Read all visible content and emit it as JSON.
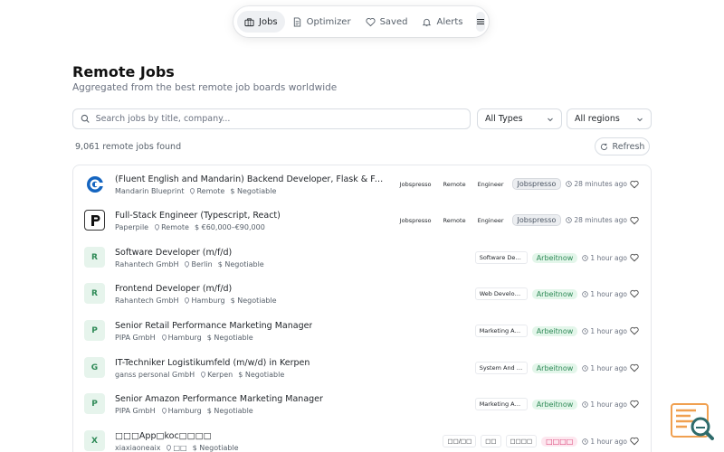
{
  "nav": {
    "items": [
      {
        "label": "Jobs",
        "icon": "briefcase-icon",
        "active": true
      },
      {
        "label": "Optimizer",
        "icon": "document-icon",
        "active": false
      },
      {
        "label": "Saved",
        "icon": "heart-icon",
        "active": false
      },
      {
        "label": "Alerts",
        "icon": "bell-icon",
        "active": false
      }
    ],
    "menu_icon": "hamburger-icon"
  },
  "header": {
    "title": "Remote Jobs",
    "subtitle": "Aggregated from the best remote job boards worldwide"
  },
  "search": {
    "placeholder": "Search jobs by title, company..."
  },
  "filters": {
    "type_value": "All Types",
    "region_value": "All regions"
  },
  "results": {
    "count_text": "9,061 remote jobs found",
    "refresh_label": "Refresh"
  },
  "jobs": [
    {
      "title": "(Fluent English and Mandarin) Backend Developer, Flask & FastAP...",
      "company": "Mandarin Blueprint",
      "location": "Remote",
      "salary": "Negotiable",
      "tags": [
        "Jobspresso",
        "Remote",
        "Engineer"
      ],
      "source": "Jobspresso",
      "time": "28 minutes ago",
      "logo": "c-logo"
    },
    {
      "title": "Full-Stack Engineer (Typescript, React)",
      "company": "Paperpile",
      "location": "Remote",
      "salary": "€60,000–€90,000",
      "tags": [
        "Jobspresso",
        "Remote",
        "Engineer"
      ],
      "source": "Jobspresso",
      "time": "28 minutes ago",
      "logo": "p-logo"
    },
    {
      "title": "Software Developer (m/f/d)",
      "company": "Rahantech GmbH",
      "location": "Berlin",
      "salary": "Negotiable",
      "tags": [
        "Software Dev..."
      ],
      "source": "Arbeitnow",
      "time": "1 hour ago",
      "letter": "R"
    },
    {
      "title": "Frontend Developer (m/f/d)",
      "company": "Rahantech GmbH",
      "location": "Hamburg",
      "salary": "Negotiable",
      "tags": [
        "Web Develop..."
      ],
      "source": "Arbeitnow",
      "time": "1 hour ago",
      "letter": "R"
    },
    {
      "title": "Senior Retail Performance Marketing Manager",
      "company": "PIPA GmbH",
      "location": "Hamburg",
      "salary": "Negotiable",
      "tags": [
        "Marketing An..."
      ],
      "source": "Arbeitnow",
      "time": "1 hour ago",
      "letter": "P"
    },
    {
      "title": "IT-Techniker Logistikumfeld (m/w/d) in Kerpen",
      "company": "ganss personal GmbH",
      "location": "Kerpen",
      "salary": "Negotiable",
      "tags": [
        "System And N..."
      ],
      "source": "Arbeitnow",
      "time": "1 hour ago",
      "letter": "G"
    },
    {
      "title": "Senior Amazon Performance Marketing Manager",
      "company": "PIPA GmbH",
      "location": "Hamburg",
      "salary": "Negotiable",
      "tags": [
        "Marketing An..."
      ],
      "source": "Arbeitnow",
      "time": "1 hour ago",
      "letter": "P"
    },
    {
      "title": "□□□App□koc□□□□",
      "company": "xiaxiaoneaix",
      "location": "□□",
      "salary": "Negotiable",
      "tags": [
        "□□/□□",
        "□□",
        "□□□□"
      ],
      "source": "□□□□",
      "time": "1 hour ago",
      "letter": "X"
    }
  ],
  "colors": {
    "accent_green": "#2f8a57",
    "pink": "#d6336c",
    "border": "#e5e7eb"
  }
}
